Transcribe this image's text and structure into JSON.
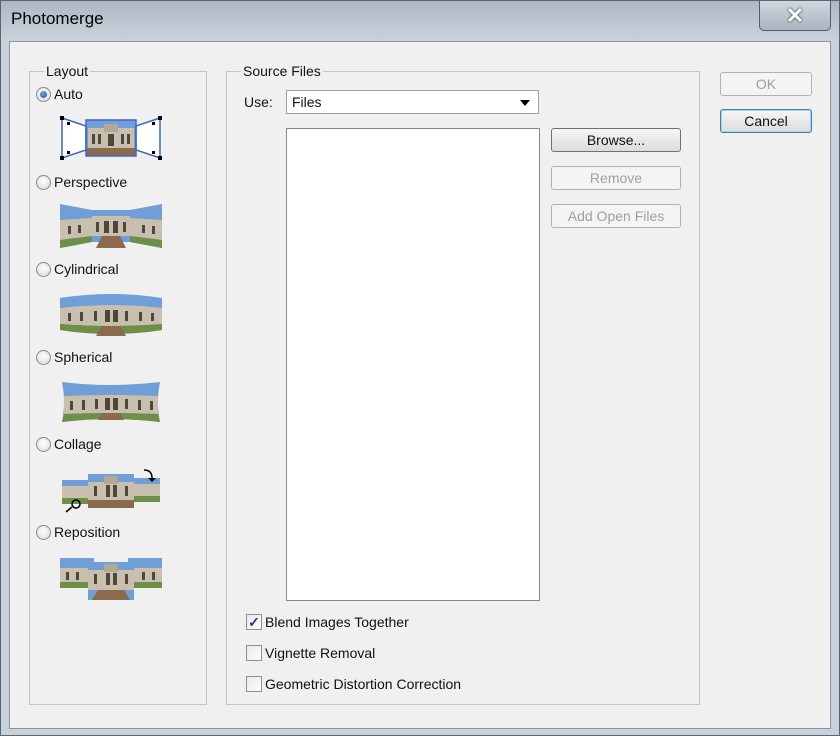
{
  "window": {
    "title": "Photomerge",
    "close_glyph": "✕"
  },
  "layout": {
    "legend": "Layout",
    "selected": "Auto",
    "options": [
      {
        "label": "Auto",
        "checked": true,
        "thumb": "auto-layout-thumbnail"
      },
      {
        "label": "Perspective",
        "checked": false,
        "thumb": "perspective-layout-thumbnail"
      },
      {
        "label": "Cylindrical",
        "checked": false,
        "thumb": "cylindrical-layout-thumbnail"
      },
      {
        "label": "Spherical",
        "checked": false,
        "thumb": "spherical-layout-thumbnail"
      },
      {
        "label": "Collage",
        "checked": false,
        "thumb": "collage-layout-thumbnail"
      },
      {
        "label": "Reposition",
        "checked": false,
        "thumb": "reposition-layout-thumbnail"
      }
    ]
  },
  "source": {
    "legend": "Source Files",
    "use_label": "Use:",
    "use_value": "Files",
    "browse_label": "Browse...",
    "remove_label": "Remove",
    "add_open_label": "Add Open Files",
    "files": []
  },
  "options": {
    "blend": {
      "label": "Blend Images Together",
      "checked": true
    },
    "vignette": {
      "label": "Vignette Removal",
      "checked": false
    },
    "geometric": {
      "label": "Geometric Distortion Correction",
      "checked": false
    }
  },
  "actions": {
    "ok_label": "OK",
    "cancel_label": "Cancel"
  },
  "colors": {
    "sky": "#6f9fd6",
    "building": "#c9bfae",
    "ground": "#8b6a4e",
    "grass": "#6d8f47",
    "check": "#1c3e7a"
  },
  "check_glyph": "✓"
}
